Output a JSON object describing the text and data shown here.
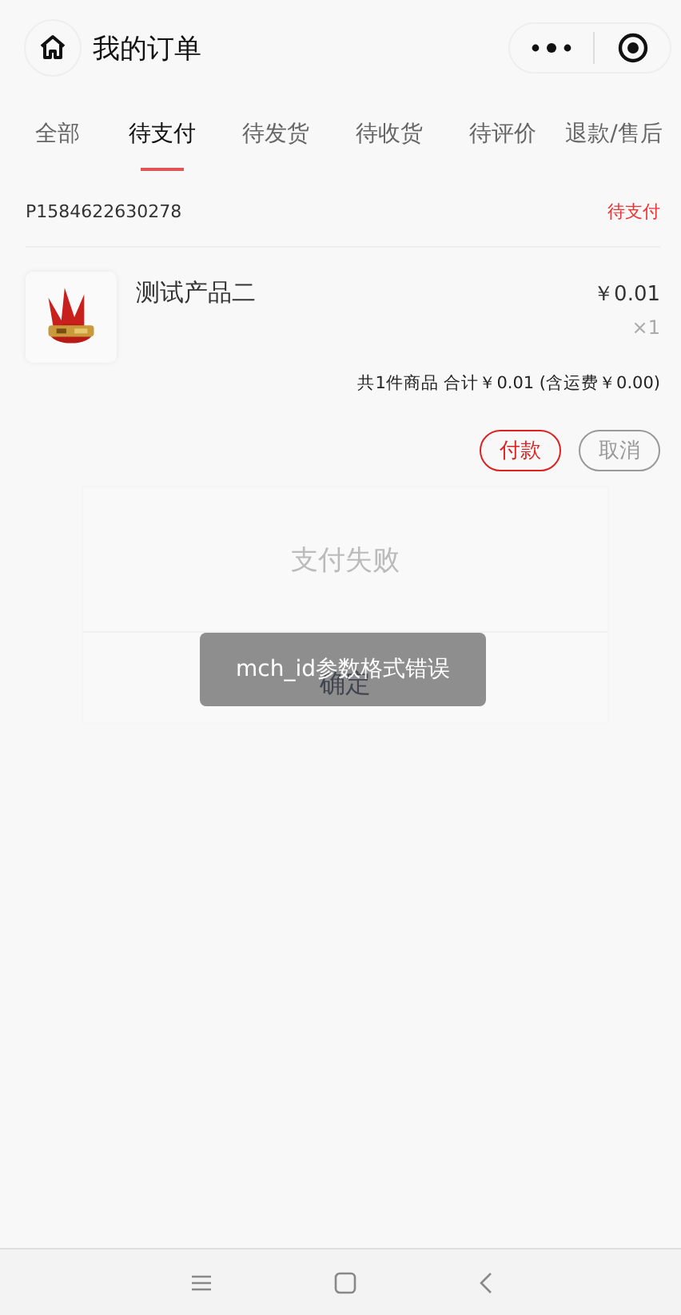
{
  "header": {
    "title": "我的订单"
  },
  "tabs": [
    {
      "label": "全部",
      "selected": false
    },
    {
      "label": "待支付",
      "selected": true
    },
    {
      "label": "待发货",
      "selected": false
    },
    {
      "label": "待收货",
      "selected": false
    },
    {
      "label": "待评价",
      "selected": false
    },
    {
      "label": "退款/售后",
      "selected": false
    }
  ],
  "orders": [
    {
      "number": "P1584622630278",
      "status": "待支付",
      "items": [
        {
          "name": "测试产品二",
          "price": "￥0.01",
          "quantity": "×1"
        }
      ],
      "summary": "共1件商品 合计￥0.01 (含运费￥0.00)",
      "actions": [
        {
          "label": "付款",
          "kind": "primary"
        },
        {
          "label": "取消",
          "kind": "secondary"
        }
      ]
    }
  ],
  "dialog": {
    "title": "支付失败",
    "button": "确定"
  },
  "toast": {
    "text": "mch_id参数格式错误"
  }
}
